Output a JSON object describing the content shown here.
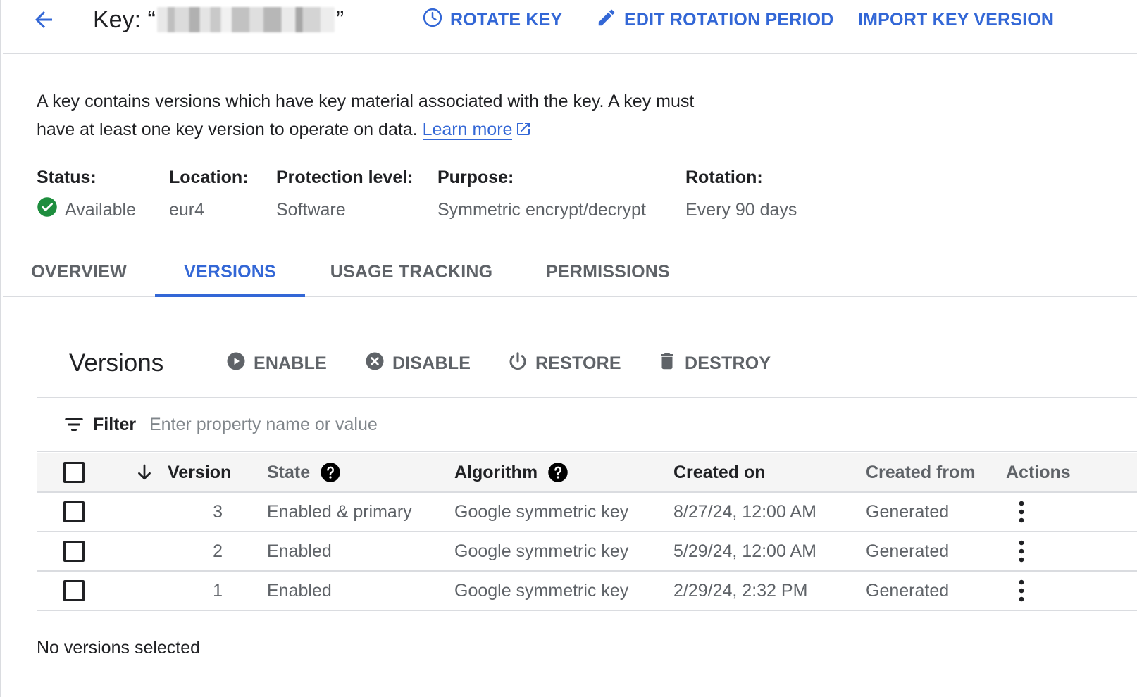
{
  "header": {
    "key_prefix": "Key: “",
    "key_suffix": "”",
    "actions": {
      "rotate": "ROTATE KEY",
      "edit_rotation": "EDIT ROTATION PERIOD",
      "import": "IMPORT KEY VERSION"
    }
  },
  "description": {
    "line1": "A key contains versions which have key material associated with the key. A key must",
    "line2": "have at least one key version to operate on data.",
    "learn_more": "Learn more"
  },
  "meta": {
    "status": {
      "label": "Status:",
      "value": "Available"
    },
    "location": {
      "label": "Location:",
      "value": "eur4"
    },
    "protection": {
      "label": "Protection level:",
      "value": "Software"
    },
    "purpose": {
      "label": "Purpose:",
      "value": "Symmetric encrypt/decrypt"
    },
    "rotation": {
      "label": "Rotation:",
      "value": "Every 90 days"
    }
  },
  "tabs": {
    "overview": "OVERVIEW",
    "versions": "VERSIONS",
    "usage": "USAGE TRACKING",
    "permissions": "PERMISSIONS",
    "active": "VERSIONS"
  },
  "versions_toolbar": {
    "title": "Versions",
    "enable": "ENABLE",
    "disable": "DISABLE",
    "restore": "RESTORE",
    "destroy": "DESTROY"
  },
  "filter": {
    "label": "Filter",
    "placeholder": "Enter property name or value"
  },
  "table": {
    "columns": {
      "version": "Version",
      "state": "State",
      "algorithm": "Algorithm",
      "created_on": "Created on",
      "created_from": "Created from",
      "actions": "Actions"
    },
    "sort": "descending",
    "rows": [
      {
        "version": "3",
        "state": "Enabled & primary",
        "algorithm": "Google symmetric key",
        "created_on": "8/27/24, 12:00 AM",
        "created_from": "Generated"
      },
      {
        "version": "2",
        "state": "Enabled",
        "algorithm": "Google symmetric key",
        "created_on": "5/29/24, 12:00 AM",
        "created_from": "Generated"
      },
      {
        "version": "1",
        "state": "Enabled",
        "algorithm": "Google symmetric key",
        "created_on": "2/29/24, 2:32 PM",
        "created_from": "Generated"
      }
    ]
  },
  "selection_status": "No versions selected",
  "colors": {
    "accent": "#3367d6",
    "success": "#1e8e3e",
    "text": "#202124",
    "muted": "#5f6368",
    "divider": "#dadce0"
  },
  "icons": {
    "back": "arrow-back-icon",
    "rotate": "clock-icon",
    "edit": "pencil-icon",
    "external": "open-in-new-icon",
    "status": "check-circle-icon",
    "enable": "play-circle-icon",
    "disable": "cancel-circle-icon",
    "restore": "power-icon",
    "destroy": "trash-icon",
    "filter": "filter-list-icon",
    "sort": "arrow-down-icon",
    "help": "help-circle-icon",
    "row_menu": "more-vert-icon"
  }
}
